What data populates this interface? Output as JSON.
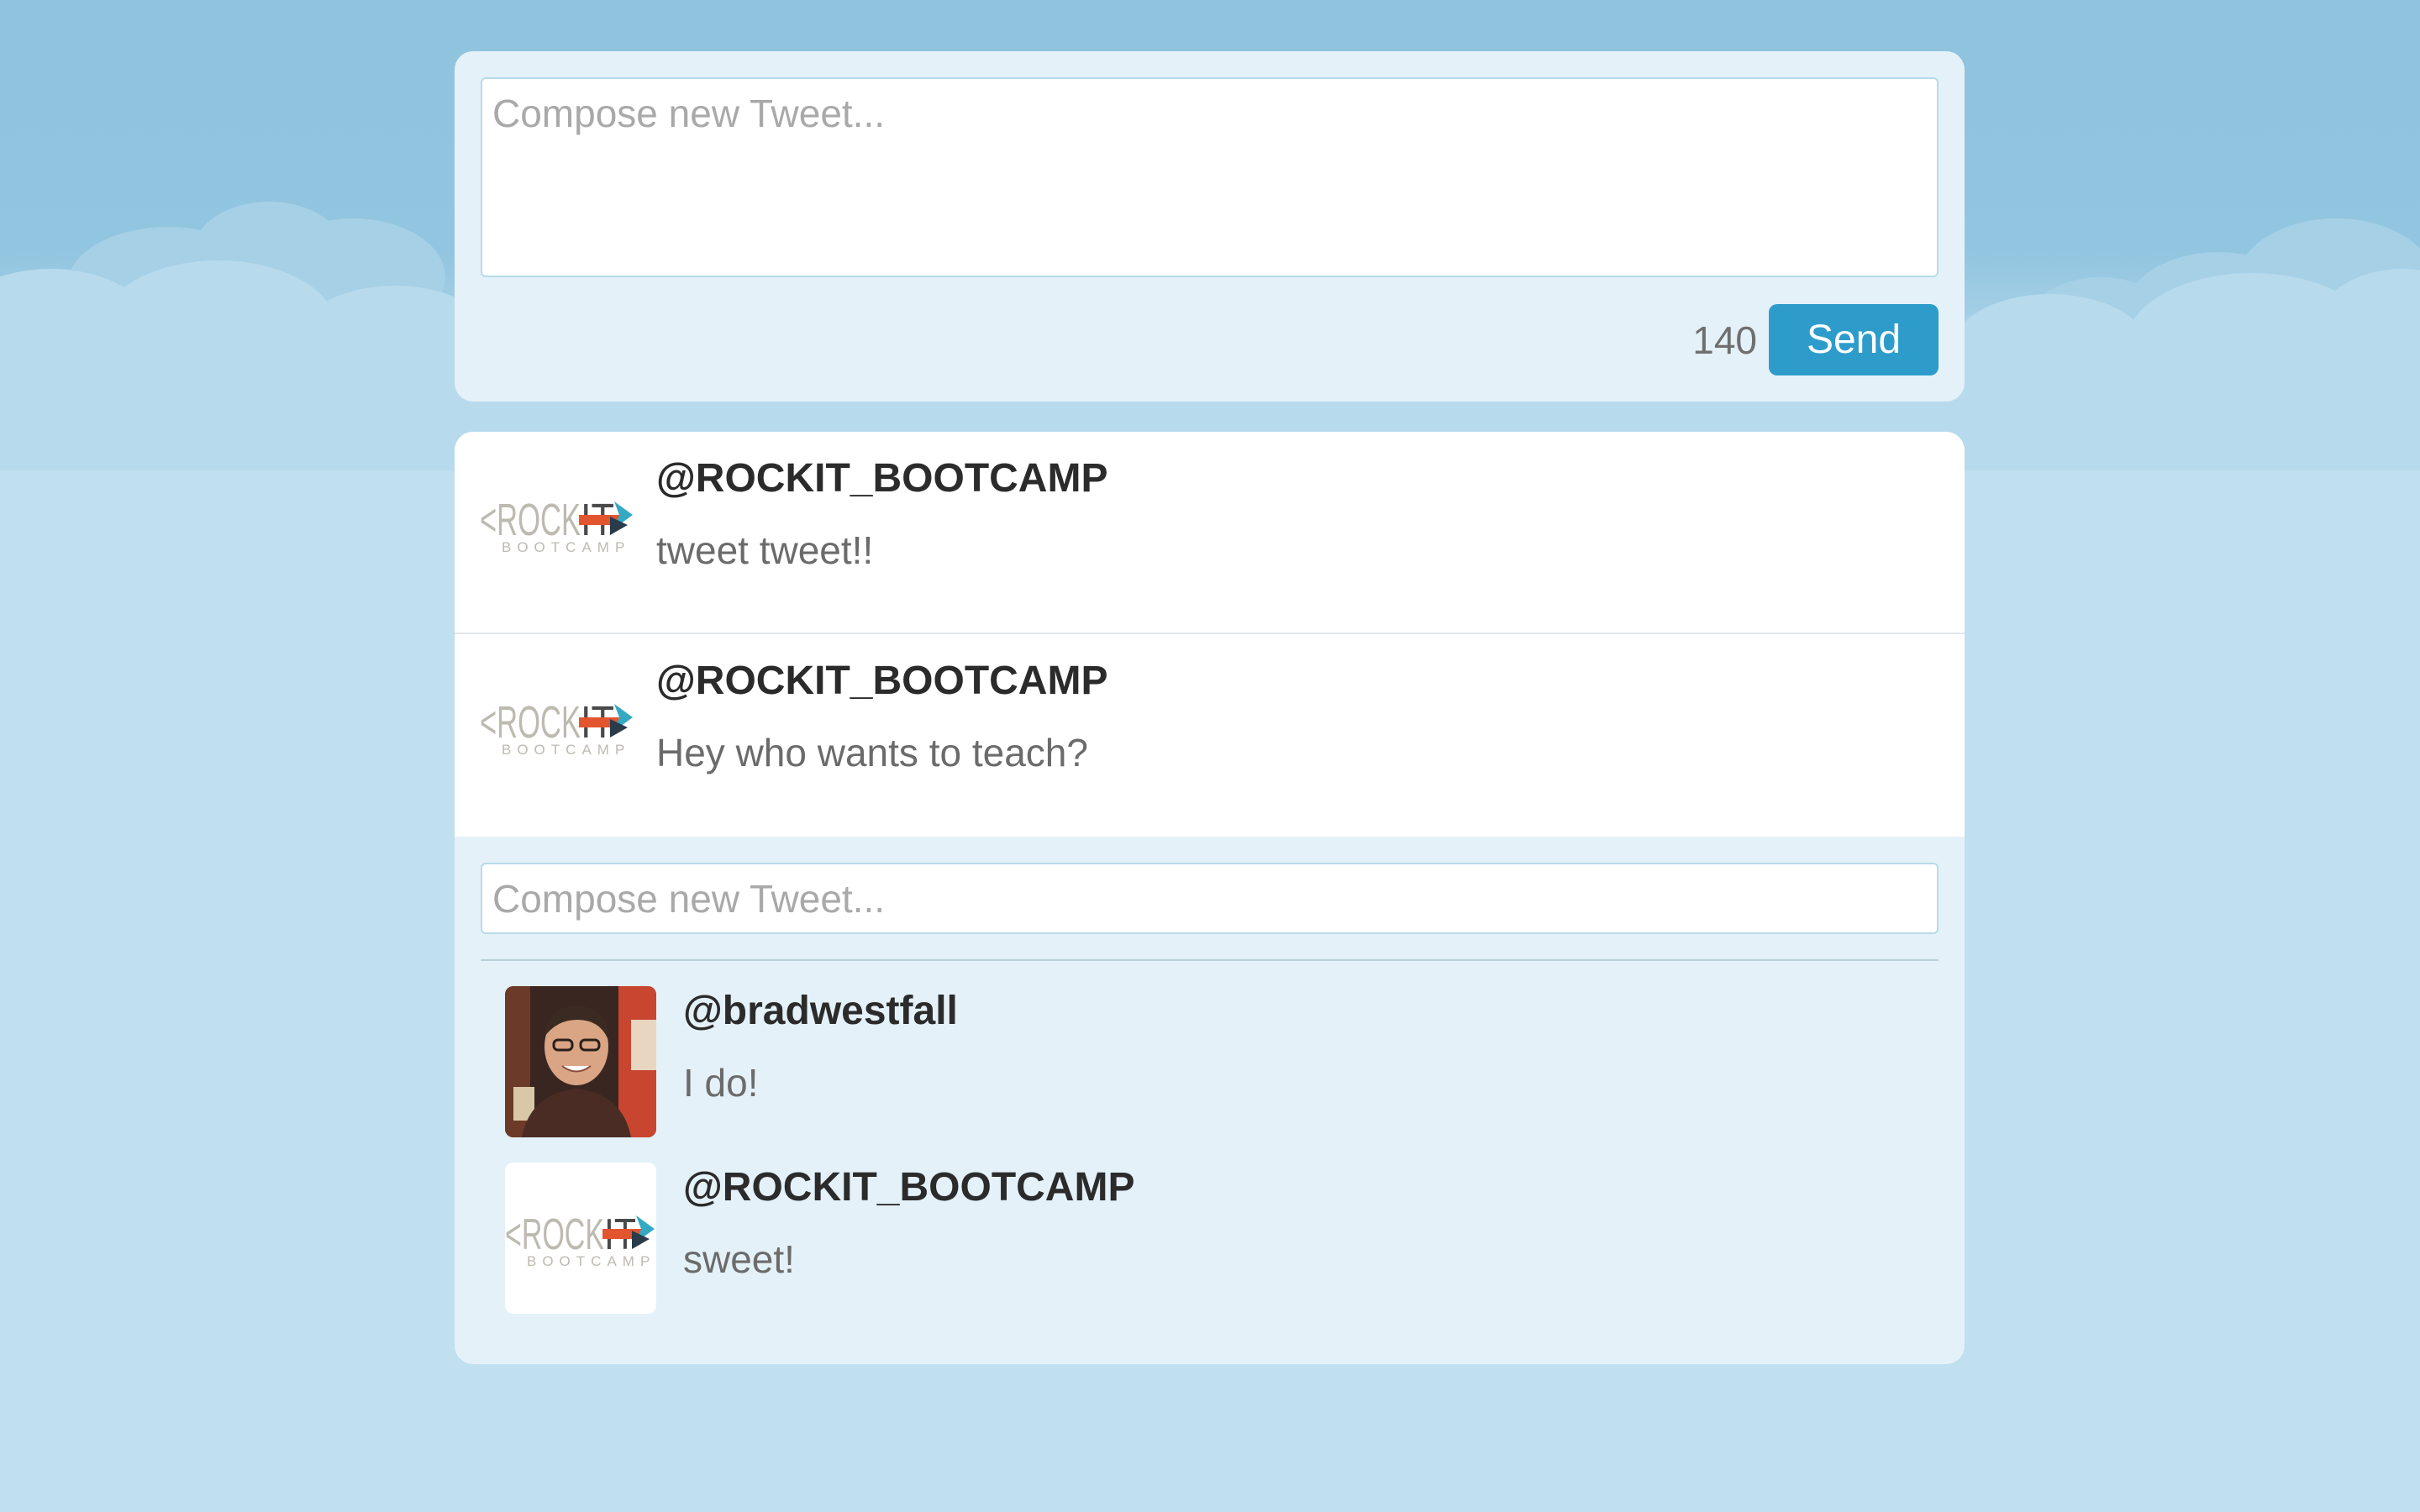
{
  "compose": {
    "placeholder": "Compose new Tweet...",
    "char_count": "140",
    "send_label": "Send"
  },
  "logo": {
    "word_left": "<ROCK",
    "word_right": "IT",
    "bracket_right": ">",
    "sub": "BOOTCAMP"
  },
  "tweets": [
    {
      "handle": "@ROCKIT_BOOTCAMP",
      "text": "tweet tweet!!",
      "avatar": "rockit-logo"
    },
    {
      "handle": "@ROCKIT_BOOTCAMP",
      "text": "Hey who wants to teach?",
      "avatar": "rockit-logo"
    }
  ],
  "thread": {
    "reply_placeholder": "Compose new Tweet...",
    "replies": [
      {
        "handle": "@bradwestfall",
        "text": "I do!",
        "avatar": "user-photo"
      },
      {
        "handle": "@ROCKIT_BOOTCAMP",
        "text": "sweet!",
        "avatar": "rockit-logo"
      }
    ]
  },
  "colors": {
    "accent": "#2e9ccb",
    "panel": "#e4f1f8",
    "sky": "#8fc3de",
    "sky_light": "#c0dfef"
  }
}
